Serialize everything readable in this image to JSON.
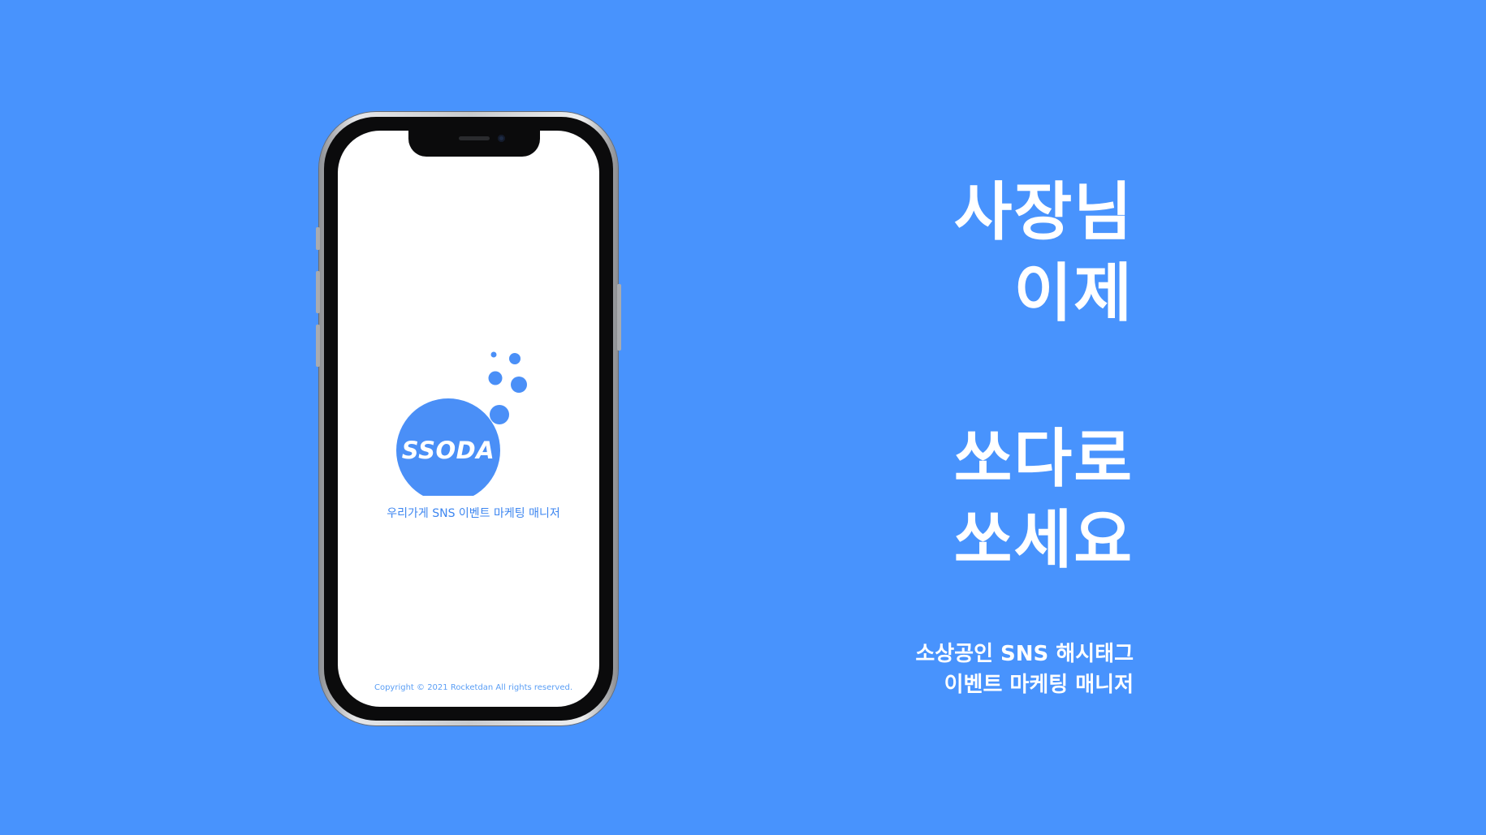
{
  "brand": {
    "logo_text": "SSODA",
    "tagline": "우리가게 SNS 이벤트 마케팅 매니저",
    "copyright": "Copyright © 2021 Rocketdan All rights reserved.",
    "accent_color": "#4893fd",
    "logo_color": "#4a8ff7"
  },
  "headline": {
    "line1": "사장님",
    "line2": "이제",
    "line3": "쏘다로",
    "line4": "쏘세요"
  },
  "subtitle": {
    "line1": "소상공인 SNS 해시태그",
    "line2": "이벤트 마케팅 매니저"
  },
  "colors": {
    "background": "#4893fd",
    "text": "#ffffff",
    "screen": "#ffffff"
  }
}
